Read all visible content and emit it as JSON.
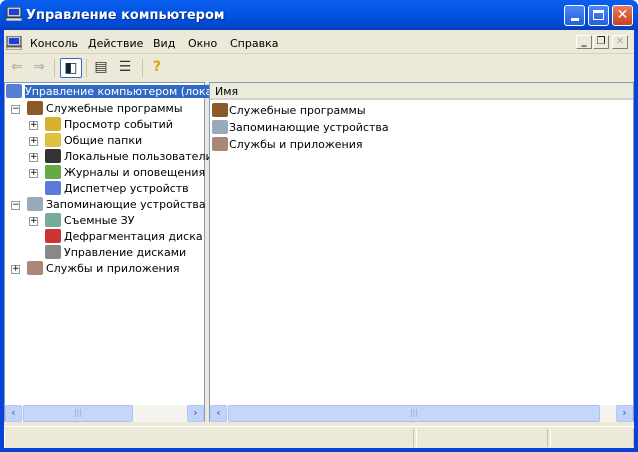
{
  "window": {
    "title": "Управление компьютером"
  },
  "menu": [
    {
      "label": "Консоль"
    },
    {
      "label": "Действие"
    },
    {
      "label": "Вид"
    },
    {
      "label": "Окно"
    },
    {
      "label": "Справка"
    }
  ],
  "toolbar": {
    "buttons": [
      "back-icon",
      "forward-icon",
      "show-hide-tree-icon",
      "properties-icon",
      "export-list-icon",
      "help-icon"
    ]
  },
  "tree": {
    "root": "Управление компьютером (локаль",
    "items": [
      {
        "label": "Служебные программы",
        "level": 1,
        "expander": "−"
      },
      {
        "label": "Просмотр событий",
        "level": 2,
        "expander": "+"
      },
      {
        "label": "Общие папки",
        "level": 2,
        "expander": "+"
      },
      {
        "label": "Локальные пользователи и",
        "level": 2,
        "expander": "+"
      },
      {
        "label": "Журналы и оповещения пр",
        "level": 2,
        "expander": "+"
      },
      {
        "label": "Диспетчер устройств",
        "level": 2,
        "expander": ""
      },
      {
        "label": "Запоминающие устройства",
        "level": 1,
        "expander": "−"
      },
      {
        "label": "Съемные ЗУ",
        "level": 2,
        "expander": "+"
      },
      {
        "label": "Дефрагментация диска",
        "level": 2,
        "expander": ""
      },
      {
        "label": "Управление дисками",
        "level": 2,
        "expander": ""
      },
      {
        "label": "Службы и приложения",
        "level": 1,
        "expander": "+"
      }
    ]
  },
  "list": {
    "column": "Имя",
    "items": [
      {
        "label": "Служебные программы"
      },
      {
        "label": "Запоминающие устройства"
      },
      {
        "label": "Службы и приложения"
      }
    ]
  },
  "colors": {
    "titlebar": "#0054e3",
    "selection": "#316ac5",
    "face": "#ece9d8"
  }
}
